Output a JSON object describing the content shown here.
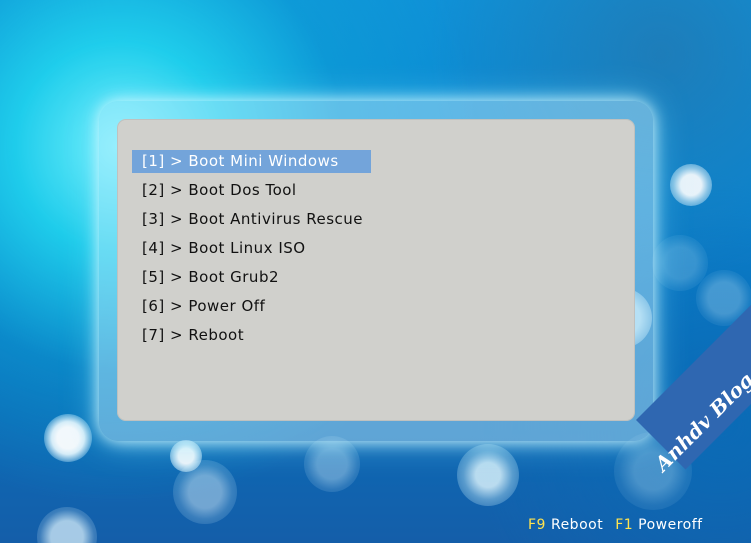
{
  "menu": {
    "items": [
      {
        "label": "[1] > Boot Mini Windows",
        "selected": true
      },
      {
        "label": "[2] > Boot Dos Tool"
      },
      {
        "label": "[3] > Boot Antivirus Rescue"
      },
      {
        "label": "[4] > Boot Linux ISO"
      },
      {
        "label": "[5] > Boot Grub2"
      },
      {
        "label": "[6] > Power Off"
      },
      {
        "label": "[7] > Reboot"
      }
    ]
  },
  "footer": {
    "reboot_key": "F9",
    "reboot_label": "Reboot",
    "poweroff_key": "F1",
    "poweroff_label": "Poweroff"
  },
  "watermark": {
    "text": "Anhdv Blog"
  }
}
